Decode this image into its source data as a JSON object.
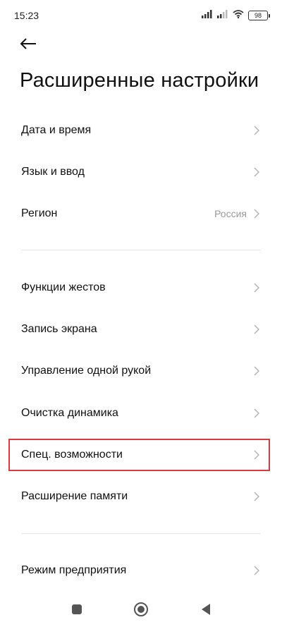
{
  "status_bar": {
    "time": "15:23",
    "battery": "98",
    "icons": [
      "signal-icon",
      "signal-icon",
      "wifi-icon",
      "battery-icon"
    ]
  },
  "header": {
    "back_icon": "back-arrow-icon",
    "title": "Расширенные настройки"
  },
  "sections": [
    {
      "items": [
        {
          "label": "Дата и время"
        },
        {
          "label": "Язык и ввод"
        },
        {
          "label": "Регион",
          "value": "Россия"
        }
      ]
    },
    {
      "items": [
        {
          "label": "Функции жестов"
        },
        {
          "label": "Запись экрана"
        },
        {
          "label": "Управление одной рукой"
        },
        {
          "label": "Очистка динамика"
        },
        {
          "label": "Спец. возможности",
          "highlighted": true
        },
        {
          "label": "Расширение памяти"
        }
      ]
    },
    {
      "items": [
        {
          "label": "Режим предприятия"
        }
      ]
    }
  ],
  "colors": {
    "highlight": "#d83a3f",
    "secondary_text": "#9a9a9a",
    "chevron": "#b5b5b5"
  },
  "nav_bar": {
    "icons": [
      "recents-square-icon",
      "home-circle-icon",
      "back-triangle-icon"
    ]
  }
}
